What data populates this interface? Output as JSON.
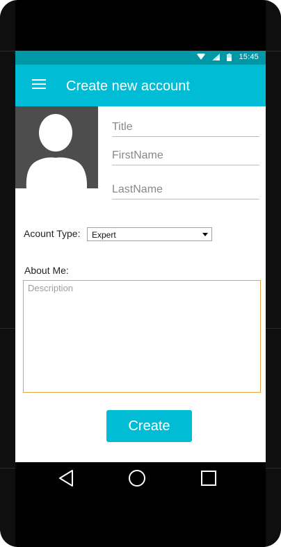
{
  "status_bar": {
    "time": "15:45",
    "icons": [
      "wifi-icon",
      "signal-icon",
      "battery-icon"
    ]
  },
  "app_bar": {
    "title": "Create new account",
    "menu_icon": "hamburger-menu-icon"
  },
  "avatar": {
    "icon": "person-silhouette-icon"
  },
  "form": {
    "title_placeholder": "Title",
    "firstname_placeholder": "FirstName",
    "lastname_placeholder": "LastName",
    "account_type_label": "Acount Type:",
    "account_type_value": "Expert",
    "about_label": "About Me:",
    "description_placeholder": "Description",
    "create_label": "Create"
  },
  "nav": {
    "icons": [
      "back-icon",
      "home-icon",
      "recents-icon"
    ]
  },
  "colors": {
    "accent": "#00bcd4",
    "status_bar": "#0097a7",
    "avatar_bg": "#4d4d4d",
    "description_border": "#e8a23a"
  }
}
